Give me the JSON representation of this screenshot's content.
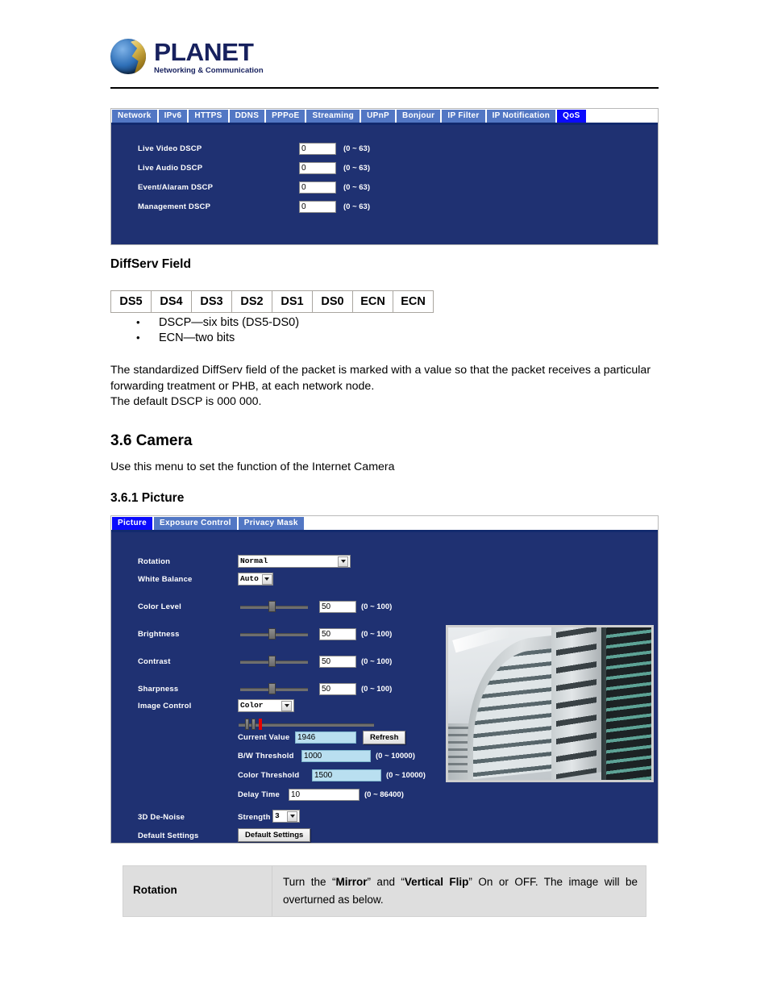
{
  "header": {
    "brand_name": "PLANET",
    "brand_tagline": "Networking & Communication"
  },
  "qos_panel": {
    "tabs": [
      {
        "label": "Network",
        "active": false
      },
      {
        "label": "IPv6",
        "active": false
      },
      {
        "label": "HTTPS",
        "active": false
      },
      {
        "label": "DDNS",
        "active": false
      },
      {
        "label": "PPPoE",
        "active": false
      },
      {
        "label": "Streaming",
        "active": false
      },
      {
        "label": "UPnP",
        "active": false
      },
      {
        "label": "Bonjour",
        "active": false
      },
      {
        "label": "IP Filter",
        "active": false
      },
      {
        "label": "IP Notification",
        "active": false
      },
      {
        "label": "QoS",
        "active": true
      }
    ],
    "fields": [
      {
        "label": "Live Video DSCP",
        "value": "0",
        "range": "(0 ~ 63)"
      },
      {
        "label": "Live Audio DSCP",
        "value": "0",
        "range": "(0 ~ 63)"
      },
      {
        "label": "Event/Alaram DSCP",
        "value": "0",
        "range": "(0 ~ 63)"
      },
      {
        "label": "Management DSCP",
        "value": "0",
        "range": "(0 ~ 63)"
      }
    ]
  },
  "diffserv": {
    "heading": "DiffServ Field",
    "cells": [
      "DS5",
      "DS4",
      "DS3",
      "DS2",
      "DS1",
      "DS0",
      "ECN",
      "ECN"
    ],
    "bullets": [
      "DSCP—six bits (DS5-DS0)",
      "ECN—two bits"
    ],
    "paragraph": "The standardized DiffServ field of the packet is marked with a value so that the packet receives a particular forwarding treatment or PHB, at each network node.\nThe default DSCP is 000 000."
  },
  "camera_section": {
    "heading": "3.6 Camera",
    "description": "Use this menu to set the function of the Internet Camera",
    "sub_heading": "3.6.1 Picture"
  },
  "picture_panel": {
    "tabs": [
      {
        "label": "Picture",
        "active": true
      },
      {
        "label": "Exposure Control",
        "active": false
      },
      {
        "label": "Privacy Mask",
        "active": false
      }
    ],
    "rotation": {
      "label": "Rotation",
      "value": "Normal"
    },
    "white_balance": {
      "label": "White Balance",
      "value": "Auto"
    },
    "sliders": [
      {
        "label": "Color Level",
        "value": "50",
        "range": "(0 ~ 100)"
      },
      {
        "label": "Brightness",
        "value": "50",
        "range": "(0 ~ 100)"
      },
      {
        "label": "Contrast",
        "value": "50",
        "range": "(0 ~ 100)"
      },
      {
        "label": "Sharpness",
        "value": "50",
        "range": "(0 ~ 100)"
      }
    ],
    "image_control": {
      "label": "Image Control",
      "value": "Color"
    },
    "current_value": {
      "label": "Current Value",
      "value": "1946",
      "button": "Refresh"
    },
    "bw_threshold": {
      "label": "B/W Threshold",
      "value": "1000",
      "range": "(0 ~ 10000)"
    },
    "color_threshold": {
      "label": "Color Threshold",
      "value": "1500",
      "range": "(0 ~ 10000)"
    },
    "delay_time": {
      "label": "Delay Time",
      "value": "10",
      "range": "(0 ~ 86400)"
    },
    "denoise": {
      "label": "3D De-Noise",
      "strength_label": "Strength",
      "value": "3"
    },
    "default_settings": {
      "label": "Default Settings",
      "button": "Default Settings"
    }
  },
  "rotation_table": {
    "label": "Rotation",
    "desc_prefix": "Turn the “",
    "desc_bold1": "Mirror",
    "desc_mid": "” and “",
    "desc_bold2": "Vertical Flip",
    "desc_suffix": "” On or OFF. The image will be overturned as below."
  }
}
